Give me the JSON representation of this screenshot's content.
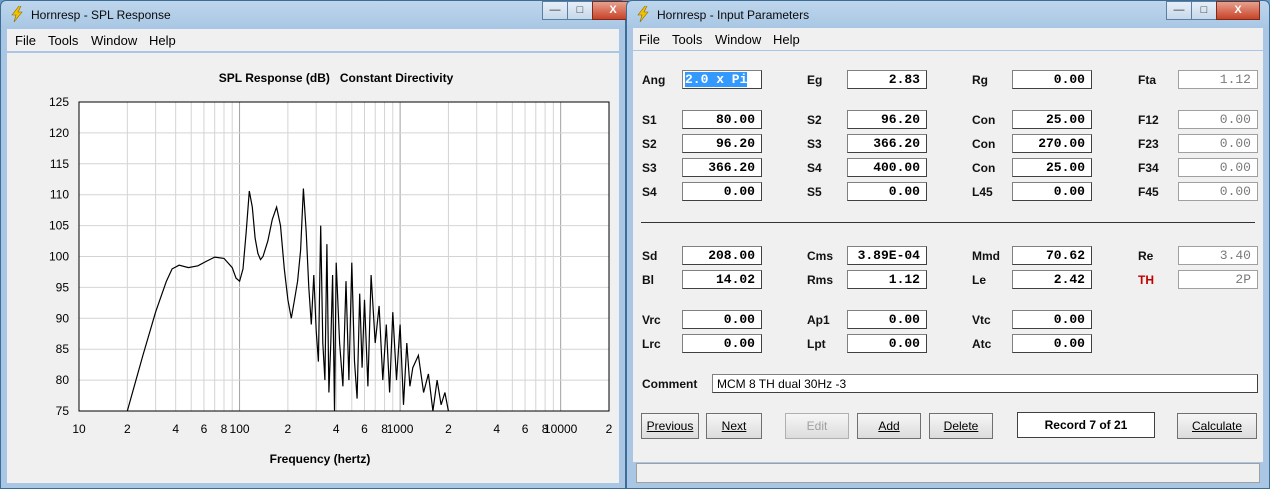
{
  "spl_window": {
    "title": "Hornresp - SPL Response",
    "menu": [
      "File",
      "Tools",
      "Window",
      "Help"
    ],
    "minimize": "—",
    "maximize": "□",
    "close": "X"
  },
  "chart_data": {
    "type": "line",
    "title": "SPL Response (dB)   Constant Directivity",
    "xlabel": "Frequency (hertz)",
    "ylabel": "",
    "x_scale": "log",
    "xlim": [
      10,
      20000
    ],
    "ylim": [
      75,
      125
    ],
    "y_ticks": [
      125,
      120,
      115,
      110,
      105,
      100,
      95,
      90,
      85,
      80,
      75
    ],
    "x_ticks": [
      {
        "v": 10,
        "label": "10"
      },
      {
        "v": 20,
        "label": "2"
      },
      {
        "v": 40,
        "label": "4"
      },
      {
        "v": 60,
        "label": "6"
      },
      {
        "v": 80,
        "label": "8"
      },
      {
        "v": 100,
        "label": "100"
      },
      {
        "v": 200,
        "label": "2"
      },
      {
        "v": 400,
        "label": "4"
      },
      {
        "v": 600,
        "label": "6"
      },
      {
        "v": 800,
        "label": "8"
      },
      {
        "v": 1000,
        "label": "1000"
      },
      {
        "v": 2000,
        "label": "2"
      },
      {
        "v": 4000,
        "label": "4"
      },
      {
        "v": 6000,
        "label": "6"
      },
      {
        "v": 8000,
        "label": "8"
      },
      {
        "v": 10000,
        "label": "10000"
      },
      {
        "v": 20000,
        "label": "2"
      }
    ],
    "grid": true,
    "series": [
      {
        "x": [
          20,
          25,
          30,
          35,
          38,
          42,
          48,
          55,
          62,
          70,
          80,
          90,
          95,
          100,
          105,
          110,
          115,
          120,
          125,
          130,
          135,
          140,
          150,
          160,
          170,
          180,
          190,
          200,
          210,
          220,
          230,
          240,
          250,
          260,
          270,
          280,
          290,
          300,
          310,
          320,
          330,
          340,
          350,
          360,
          370,
          380,
          390,
          400,
          420,
          440,
          460,
          480,
          500,
          520,
          540,
          560,
          580,
          600,
          630,
          660,
          700,
          740,
          780,
          820,
          860,
          900,
          950,
          1000,
          1050,
          1100,
          1150,
          1200,
          1300,
          1400,
          1500,
          1600,
          1700,
          1800,
          1900,
          2000
        ],
        "y": [
          75,
          84,
          91,
          96,
          98,
          98.6,
          98.2,
          98.5,
          99.2,
          99.9,
          99.7,
          98.2,
          96.5,
          96,
          98,
          104,
          110.6,
          108,
          103,
          100.5,
          99.5,
          100,
          102.5,
          106,
          108,
          105,
          98,
          93,
          90,
          93,
          96,
          101,
          111,
          104,
          95,
          89,
          97,
          88,
          83,
          105,
          86,
          80,
          102,
          78,
          86,
          97,
          75,
          99,
          86,
          79,
          96,
          80,
          99,
          83,
          77,
          94,
          82,
          93,
          79,
          97,
          86,
          92,
          80,
          89,
          78,
          91,
          80,
          89,
          76,
          86,
          79,
          82,
          84,
          78,
          81,
          75,
          80,
          76,
          78,
          75
        ]
      }
    ]
  },
  "ip_window": {
    "title": "Hornresp - Input Parameters",
    "menu": [
      "File",
      "Tools",
      "Window",
      "Help"
    ],
    "minimize": "—",
    "maximize": "□",
    "close": "X",
    "rows": [
      [
        {
          "l": "Ang",
          "v": "2.0 x Pi"
        },
        {
          "l": "Eg",
          "v": "2.83"
        },
        {
          "l": "Rg",
          "v": "0.00"
        },
        {
          "l": "Fta",
          "v": "1.12"
        }
      ],
      [
        {
          "l": "S1",
          "v": "80.00"
        },
        {
          "l": "S2",
          "v": "96.20"
        },
        {
          "l": "Con",
          "v": "25.00"
        },
        {
          "l": "F12",
          "v": "0.00"
        }
      ],
      [
        {
          "l": "S2",
          "v": "96.20"
        },
        {
          "l": "S3",
          "v": "366.20"
        },
        {
          "l": "Con",
          "v": "270.00"
        },
        {
          "l": "F23",
          "v": "0.00"
        }
      ],
      [
        {
          "l": "S3",
          "v": "366.20"
        },
        {
          "l": "S4",
          "v": "400.00"
        },
        {
          "l": "Con",
          "v": "25.00"
        },
        {
          "l": "F34",
          "v": "0.00"
        }
      ],
      [
        {
          "l": "S4",
          "v": "0.00"
        },
        {
          "l": "S5",
          "v": "0.00"
        },
        {
          "l": "L45",
          "v": "0.00"
        },
        {
          "l": "F45",
          "v": "0.00"
        }
      ],
      [
        {
          "l": "Sd",
          "v": "208.00"
        },
        {
          "l": "Cms",
          "v": "3.89E-04"
        },
        {
          "l": "Mmd",
          "v": "70.62"
        },
        {
          "l": "Re",
          "v": "3.40"
        }
      ],
      [
        {
          "l": "Bl",
          "v": "14.02"
        },
        {
          "l": "Rms",
          "v": "1.12"
        },
        {
          "l": "Le",
          "v": "2.42"
        },
        {
          "l": "TH",
          "v": "2P"
        }
      ],
      [
        {
          "l": "Vrc",
          "v": "0.00"
        },
        {
          "l": "Ap1",
          "v": "0.00"
        },
        {
          "l": "Vtc",
          "v": "0.00"
        }
      ],
      [
        {
          "l": "Lrc",
          "v": "0.00"
        },
        {
          "l": "Lpt",
          "v": "0.00"
        },
        {
          "l": "Atc",
          "v": "0.00"
        }
      ]
    ],
    "comment_label": "Comment",
    "comment_value": "MCM 8 TH dual 30Hz -3",
    "buttons": {
      "previous": "Previous",
      "next": "Next",
      "edit": "Edit",
      "add": "Add",
      "delete": "Delete",
      "calculate": "Calculate"
    },
    "record": "Record 7 of 21",
    "colors": {
      "th_label": "#c00000",
      "selection": "#3399ff"
    }
  }
}
